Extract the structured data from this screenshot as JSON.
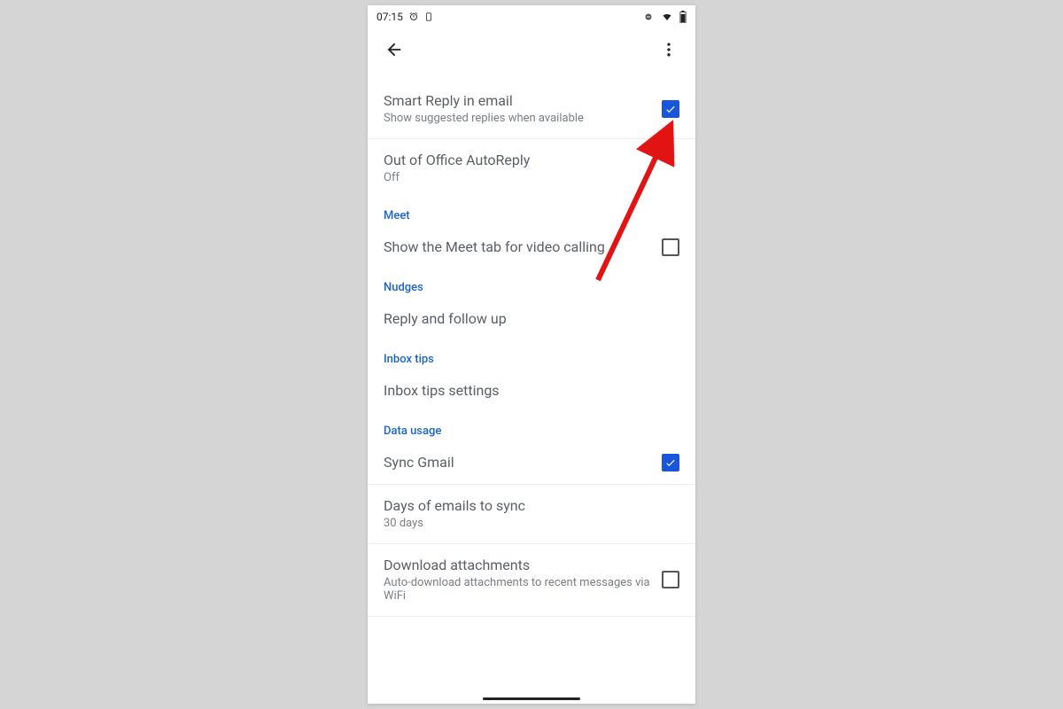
{
  "status": {
    "time": "07:15"
  },
  "settings": {
    "smart_reply": {
      "title": "Smart Reply in email",
      "sub": "Show suggested replies when available",
      "checked": true
    },
    "out_of_office": {
      "title": "Out of Office AutoReply",
      "sub": "Off"
    },
    "meet_header": "Meet",
    "meet_tab": {
      "title": "Show the Meet tab for video calling",
      "checked": false
    },
    "nudges_header": "Nudges",
    "nudges_item": {
      "title": "Reply and follow up"
    },
    "inbox_tips_header": "Inbox tips",
    "inbox_tips_item": {
      "title": "Inbox tips settings"
    },
    "data_usage_header": "Data usage",
    "sync_gmail": {
      "title": "Sync Gmail",
      "checked": true
    },
    "days_sync": {
      "title": "Days of emails to sync",
      "sub": "30 days"
    },
    "download_attachments": {
      "title": "Download attachments",
      "sub": "Auto-download attachments to recent messages via WiFi",
      "checked": false
    }
  },
  "annotation": {
    "arrow_color": "#e11313"
  }
}
